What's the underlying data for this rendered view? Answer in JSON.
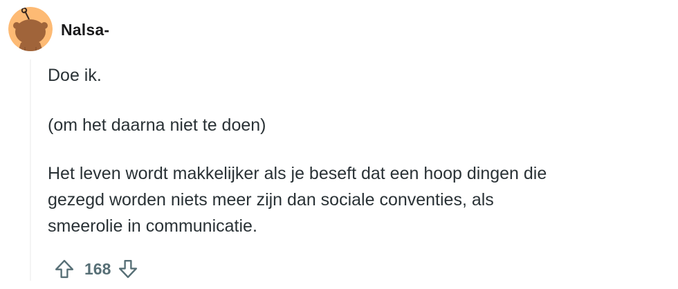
{
  "comment": {
    "author": "Nalsa-",
    "avatar": {
      "icon": "snoo-avatar-icon",
      "background_color": "#fdba74",
      "figure_color": "#a0643a"
    },
    "paragraphs": {
      "p1": "Doe ik.",
      "p2": "(om het daarna niet te doen)",
      "p3_lines": [
        "Het leven wordt makkelijker als je beseft dat een hoop dingen die",
        "gezegd worden niets meer zijn dan sociale conventies, als",
        "smeerolie in communicatie."
      ]
    },
    "actions": {
      "upvote_icon": "arrow-up-outline-icon",
      "score": "168",
      "downvote_icon": "arrow-down-outline-icon",
      "icon_color": "#576f76"
    }
  }
}
